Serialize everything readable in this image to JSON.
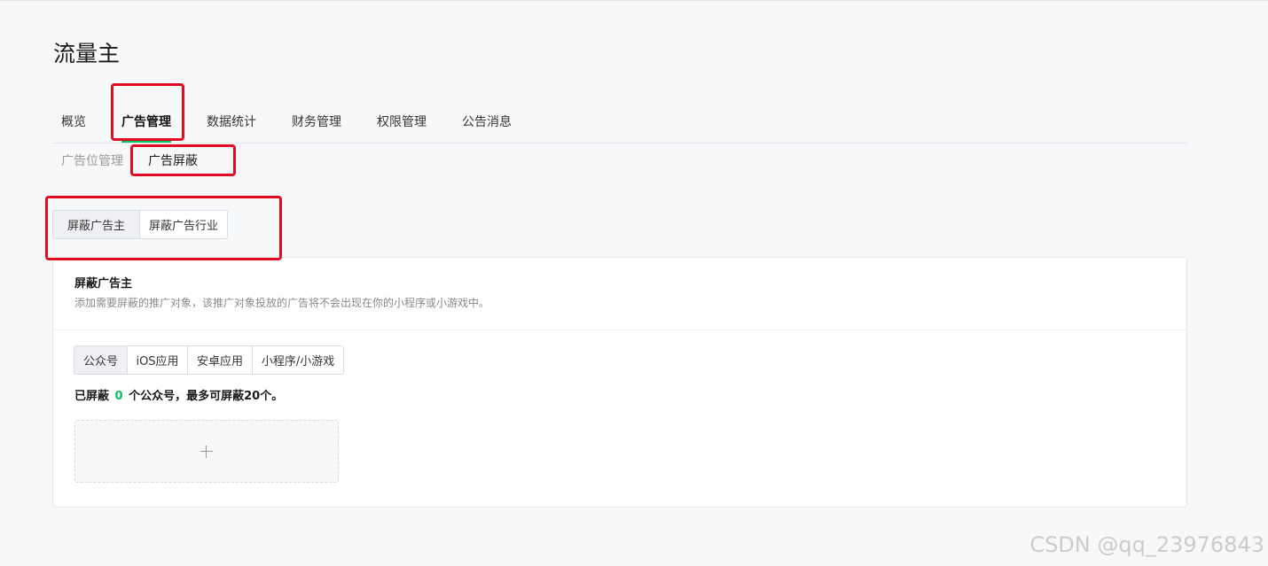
{
  "app": {
    "title": "流量主"
  },
  "main_tabs": [
    {
      "label": "概览"
    },
    {
      "label": "广告管理",
      "active": true
    },
    {
      "label": "数据统计"
    },
    {
      "label": "财务管理"
    },
    {
      "label": "权限管理"
    },
    {
      "label": "公告消息"
    }
  ],
  "sub_tabs": [
    {
      "label": "广告位管理"
    },
    {
      "label": "广告屏蔽",
      "active": true
    }
  ],
  "block_type": {
    "options": [
      "屏蔽广告主",
      "屏蔽广告行业"
    ],
    "selected": "屏蔽广告主"
  },
  "card": {
    "title": "屏蔽广告主",
    "description": "添加需要屏蔽的推广对象，该推广对象投放的广告将不会出现在你的小程序或小游戏中。",
    "object_tabs": [
      "公众号",
      "iOS应用",
      "安卓应用",
      "小程序/小游戏"
    ],
    "selected_object_tab": "公众号",
    "count_prefix": "已屏蔽",
    "count_value": "0",
    "count_suffix": "个公众号，最多可屏蔽20个。",
    "add_icon": "plus-icon"
  },
  "watermark": "CSDN @qq_23976843",
  "colors": {
    "accent": "#07c160",
    "annotation": "#e30b22"
  }
}
